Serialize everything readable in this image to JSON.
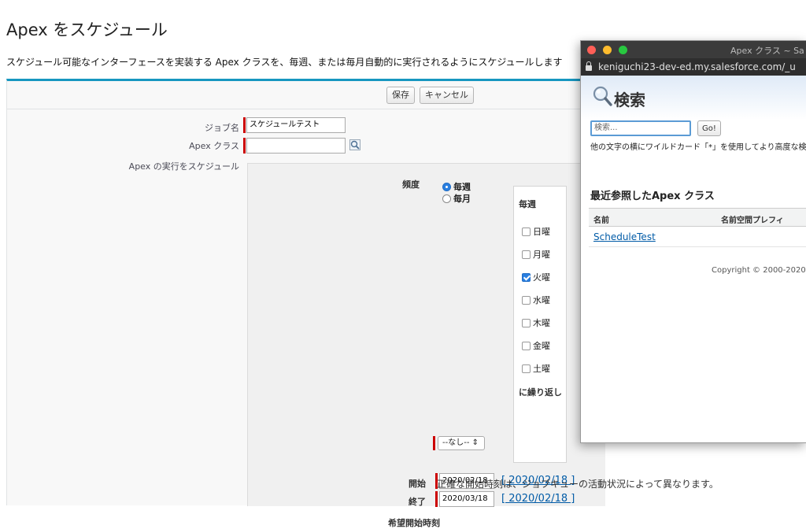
{
  "page": {
    "title": "Apex をスケジュール",
    "description": "スケジュール可能なインターフェースを実装する Apex クラスを、毎週、または毎月自動的に実行されるようにスケジュールします"
  },
  "buttons": {
    "save": "保存",
    "cancel": "キャンセル"
  },
  "form": {
    "job_name_label": "ジョブ名",
    "job_name_value": "スケジュールテスト",
    "apex_class_label": "Apex クラス",
    "apex_class_value": "",
    "schedule_label": "Apex の実行をスケジュール",
    "frequency_label": "頻度",
    "frequency_options": [
      "毎週",
      "毎月"
    ],
    "frequency_selected": "毎週",
    "weekly_heading": "毎週",
    "days": [
      {
        "label": "日曜",
        "checked": false
      },
      {
        "label": "月曜",
        "checked": false
      },
      {
        "label": "火曜",
        "checked": true
      },
      {
        "label": "水曜",
        "checked": false
      },
      {
        "label": "木曜",
        "checked": false
      },
      {
        "label": "金曜",
        "checked": false
      },
      {
        "label": "土曜",
        "checked": false
      }
    ],
    "repeat_label": "に繰り返し",
    "start_label": "開始",
    "start_value": "2020/02/18",
    "start_link": "[ 2020/02/18 ]",
    "end_label": "終了",
    "end_value": "2020/03/18",
    "end_link": "[ 2020/02/18 ]",
    "preferred_time_label": "希望開始時刻",
    "preferred_time_value": "--なし-- ⇕",
    "note": "正確な開始時刻は、ジョブキューの活動状況によって異なります。"
  },
  "popup": {
    "window_title": "Apex クラス ~ Sa",
    "url": "keniguchi23-dev-ed.my.salesforce.com/_u",
    "search_title": "検索",
    "search_placeholder": "検索...",
    "go_label": "Go!",
    "hint": "他の文字の横にワイルドカード「*」を使用してより高度な検",
    "recent_title": "最近参照したApex クラス",
    "columns": [
      "名前",
      "名前空間プレフィ"
    ],
    "rows": [
      {
        "name": "ScheduleTest"
      }
    ],
    "copyright": "Copyright © 2000-2020",
    "traffic_light_colors": [
      "#ff5f57",
      "#febc2e",
      "#28c840"
    ]
  }
}
